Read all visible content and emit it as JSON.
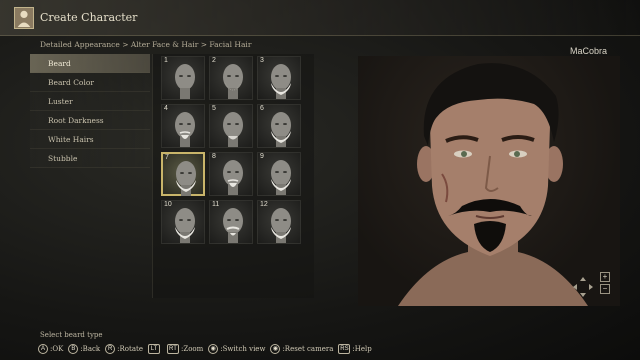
{
  "header": {
    "title": "Create Character",
    "portrait_icon": "character-portrait-icon"
  },
  "breadcrumb": "Detailed Appearance > Alter Face & Hair > Facial Hair",
  "username": "MaCobra",
  "menu": {
    "selected_index": 0,
    "items": [
      {
        "label": "Beard"
      },
      {
        "label": "Beard Color"
      },
      {
        "label": "Luster"
      },
      {
        "label": "Root Darkness"
      },
      {
        "label": "White Hairs"
      },
      {
        "label": "Stubble"
      }
    ]
  },
  "beard_grid": {
    "selected": "7",
    "cells": [
      {
        "num": "1"
      },
      {
        "num": "2"
      },
      {
        "num": "3"
      },
      {
        "num": "4"
      },
      {
        "num": "5"
      },
      {
        "num": "6"
      },
      {
        "num": "7"
      },
      {
        "num": "8"
      },
      {
        "num": "9"
      },
      {
        "num": "10"
      },
      {
        "num": "11"
      },
      {
        "num": "12"
      }
    ]
  },
  "camera": {
    "plus": "+",
    "minus": "−",
    "arrows_icon": "camera-pan-arrows-icon"
  },
  "help_text": "Select beard type",
  "controls": [
    {
      "key": "A",
      "label": ":OK",
      "icon": "button-a-icon"
    },
    {
      "key": "B",
      "label": ":Back",
      "icon": "button-b-icon"
    },
    {
      "key": "R",
      "label": ":Rotate",
      "icon": "right-stick-icon"
    },
    {
      "key": "LT",
      "label": "",
      "icon": "lt-trigger-icon"
    },
    {
      "key": "RT",
      "label": ":Zoom",
      "icon": "rt-trigger-icon"
    },
    {
      "key": "◉",
      "label": ":Switch view",
      "icon": "view-button-icon"
    },
    {
      "key": "◉",
      "label": ":Reset camera",
      "icon": "menu-button-icon"
    },
    {
      "key": "RS",
      "label": ":Help",
      "icon": "right-stick-press-icon"
    }
  ],
  "colors": {
    "accent": "#c9b56a",
    "selected_row": "#827c68"
  }
}
